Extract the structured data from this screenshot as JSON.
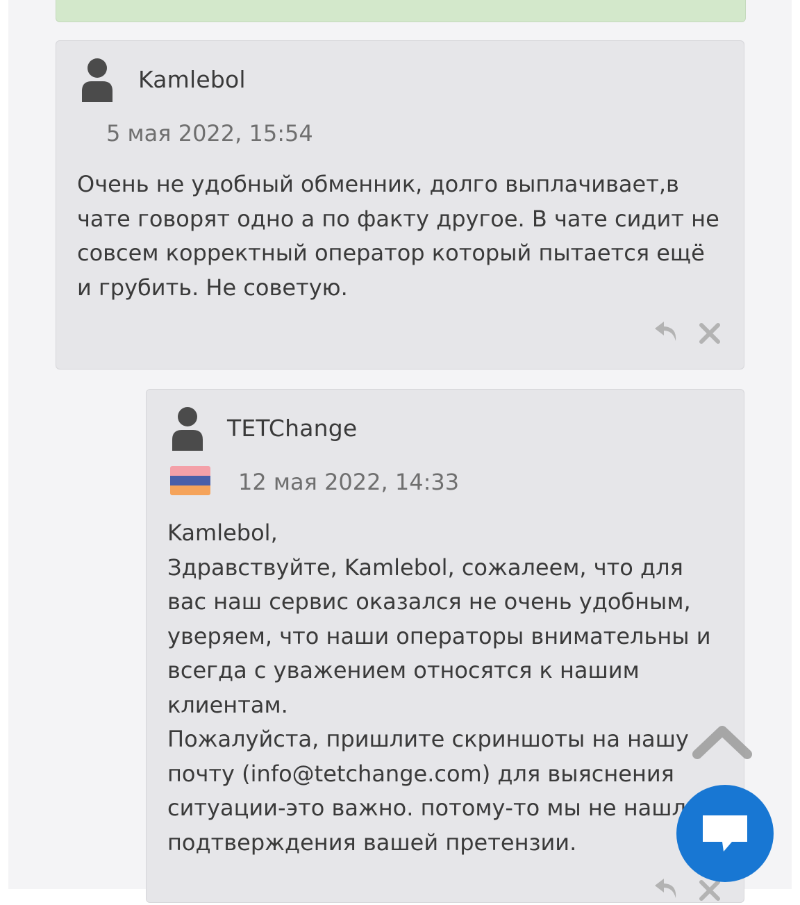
{
  "comments": [
    {
      "author": "Kamlebol",
      "date": "5 мая 2022, 15:54",
      "text": "Очень не удобный обменник, долго выплачивает,в\nчате говорят одно а по факту другое. В чате сидит не\nсовсем корректный оператор который пытается ещё\nи грубить. Не советую."
    },
    {
      "author": "TETChange",
      "date": "12 мая 2022, 14:33",
      "flag_colors": [
        "#f4a0a8",
        "#4a5fa8",
        "#f5a35a"
      ],
      "text": "Kamlebol,\nЗдравствуйте, Kamlebol, сожалеем, что для\nвас наш сервис оказался не очень удобным,\nуверяем, что наши операторы внимательны и\nвсегда с уважением относятся к нашим\nклиентам.\nПожалуйста, пришлите скриншоты на нашу\nпочту (info@tetchange.com) для выяснения\nситуации-это важно. потому-то мы не нашли\nподтверждения вашей претензии."
    }
  ],
  "icons": {
    "avatar": "user-icon",
    "reply": "reply-icon",
    "delete": "close-icon",
    "scroll_up": "chevron-up-icon",
    "chat": "chat-icon"
  },
  "colors": {
    "comment_bg": "#e6e6e9",
    "banner_bg": "#d3e8cb",
    "chat_button": "#1877d3",
    "icon_gray": "#b3b3b3"
  }
}
